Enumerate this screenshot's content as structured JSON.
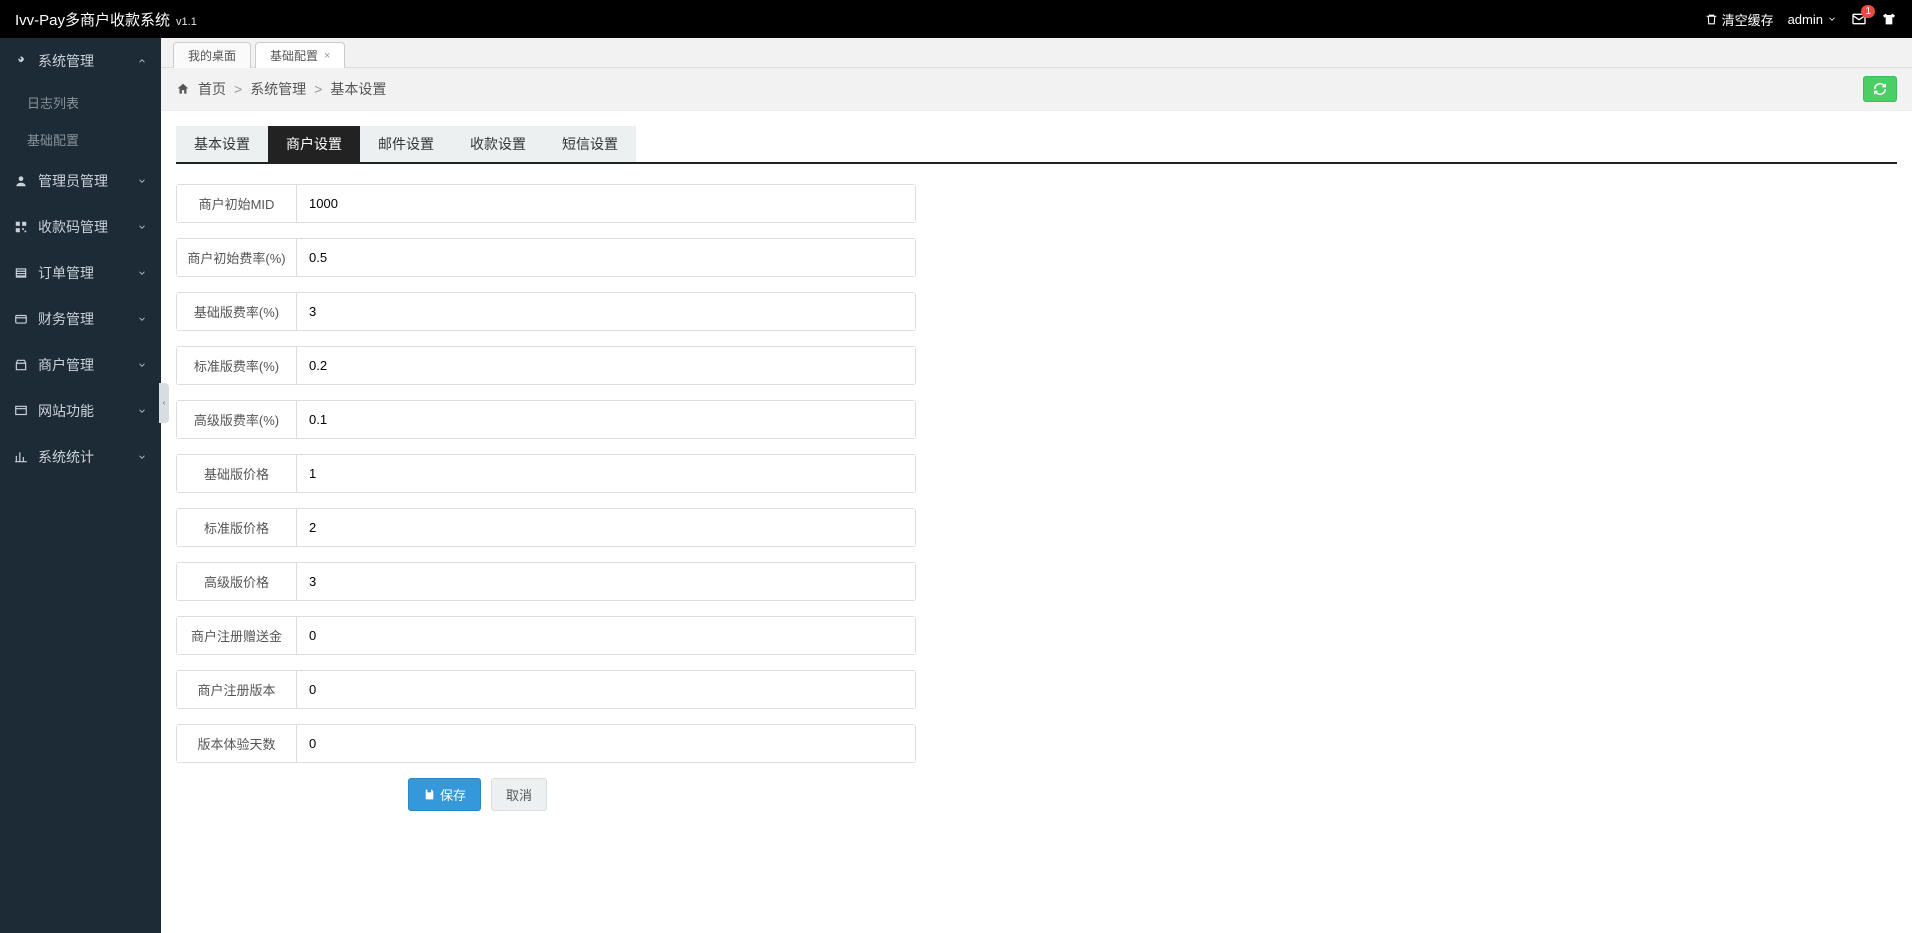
{
  "header": {
    "title": "Ivv-Pay多商户收款系统",
    "version": "v1.1",
    "clear_cache": "清空缓存",
    "user": "admin",
    "mail_badge": "1"
  },
  "sidebar": {
    "items": [
      {
        "icon": "tools",
        "label": "系统管理",
        "expanded": true,
        "children": [
          {
            "label": "日志列表"
          },
          {
            "label": "基础配置"
          }
        ]
      },
      {
        "icon": "user",
        "label": "管理员管理",
        "expanded": false
      },
      {
        "icon": "qrcode",
        "label": "收款码管理",
        "expanded": false
      },
      {
        "icon": "list",
        "label": "订单管理",
        "expanded": false
      },
      {
        "icon": "wallet",
        "label": "财务管理",
        "expanded": false
      },
      {
        "icon": "shop",
        "label": "商户管理",
        "expanded": false
      },
      {
        "icon": "site",
        "label": "网站功能",
        "expanded": false
      },
      {
        "icon": "chart",
        "label": "系统统计",
        "expanded": false
      }
    ]
  },
  "page_tabs": [
    {
      "label": "我的桌面",
      "closable": false,
      "active": false
    },
    {
      "label": "基础配置",
      "closable": true,
      "active": true
    }
  ],
  "breadcrumb": {
    "home": "首页",
    "items": [
      "系统管理",
      "基本设置"
    ]
  },
  "inner_tabs": [
    {
      "label": "基本设置",
      "active": false
    },
    {
      "label": "商户设置",
      "active": true
    },
    {
      "label": "邮件设置",
      "active": false
    },
    {
      "label": "收款设置",
      "active": false
    },
    {
      "label": "短信设置",
      "active": false
    }
  ],
  "form": {
    "rows": [
      {
        "label": "商户初始MID",
        "value": "1000"
      },
      {
        "label": "商户初始费率(%)",
        "value": "0.5"
      },
      {
        "label": "基础版费率(%)",
        "value": "3"
      },
      {
        "label": "标准版费率(%)",
        "value": "0.2"
      },
      {
        "label": "高级版费率(%)",
        "value": "0.1"
      },
      {
        "label": "基础版价格",
        "value": "1"
      },
      {
        "label": "标准版价格",
        "value": "2"
      },
      {
        "label": "高级版价格",
        "value": "3"
      },
      {
        "label": "商户注册赠送金",
        "value": "0"
      },
      {
        "label": "商户注册版本",
        "value": "0"
      },
      {
        "label": "版本体验天数",
        "value": "0"
      }
    ],
    "save": "保存",
    "cancel": "取消"
  }
}
